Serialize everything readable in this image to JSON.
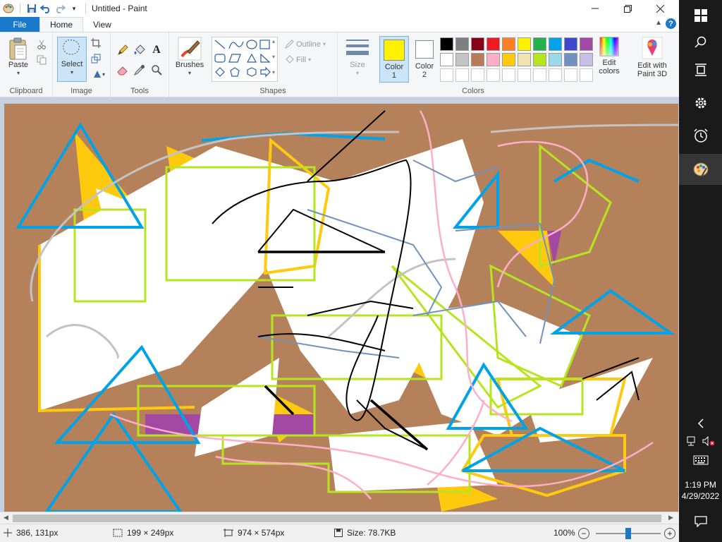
{
  "window": {
    "title": "Untitled - Paint"
  },
  "tabs": [
    {
      "label": "File"
    },
    {
      "label": "Home"
    },
    {
      "label": "View"
    }
  ],
  "help_label": "?",
  "ribbon": {
    "clipboard": {
      "group_label": "Clipboard",
      "paste_label": "Paste"
    },
    "image": {
      "group_label": "Image",
      "select_label": "Select"
    },
    "tools": {
      "group_label": "Tools"
    },
    "brushes": {
      "label": "Brushes"
    },
    "shapes": {
      "group_label": "Shapes",
      "outline_label": "Outline",
      "fill_label": "Fill"
    },
    "size": {
      "label": "Size"
    },
    "colors": {
      "group_label": "Colors",
      "color1_label": "Color\n1",
      "color2_label": "Color\n2",
      "edit_colors_label": "Edit\ncolors",
      "edit3d_label": "Edit with\nPaint 3D",
      "color1": "#fff200",
      "color2": "#ffffff",
      "palette_row1": [
        "#000000",
        "#7f7f7f",
        "#880015",
        "#ed1c24",
        "#ff7f27",
        "#fff200",
        "#22b14c",
        "#00a2e8",
        "#3f48cc",
        "#a349a4"
      ],
      "palette_row2": [
        "#ffffff",
        "#c3c3c3",
        "#b97a57",
        "#ffaec9",
        "#ffc90e",
        "#efe4b0",
        "#b5e61d",
        "#99d9ea",
        "#7092be",
        "#c8bfe7"
      ]
    }
  },
  "status": {
    "cursor_pos": "386, 131px",
    "selection_size": "199 × 249px",
    "image_size": "974 × 574px",
    "file_size": "Size: 78.7KB",
    "zoom": "100%",
    "zoom_level": 0.5
  },
  "taskbar": {
    "time": "1:19 PM",
    "date": "4/29/2022"
  },
  "canvas": {
    "background": "#b5815a"
  }
}
